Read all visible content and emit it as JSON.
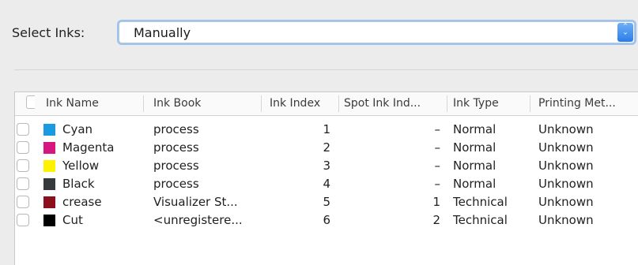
{
  "select_inks": {
    "label": "Select Inks:",
    "value": "Manually"
  },
  "table": {
    "columns": [
      "Ink Name",
      "Ink Book",
      "Ink Index",
      "Spot Ink Ind...",
      "Ink Type",
      "Printing Met..."
    ],
    "rows": [
      {
        "name": "Cyan",
        "book": "process",
        "index": "1",
        "spot": "–",
        "type": "Normal",
        "printing": "Unknown",
        "color": "#1a9ae0"
      },
      {
        "name": "Magenta",
        "book": "process",
        "index": "2",
        "spot": "–",
        "type": "Normal",
        "printing": "Unknown",
        "color": "#d5177f"
      },
      {
        "name": "Yellow",
        "book": "process",
        "index": "3",
        "spot": "–",
        "type": "Normal",
        "printing": "Unknown",
        "color": "#fff200"
      },
      {
        "name": "Black",
        "book": "process",
        "index": "4",
        "spot": "–",
        "type": "Normal",
        "printing": "Unknown",
        "color": "#373a3d"
      },
      {
        "name": "crease",
        "book": "Visualizer St...",
        "index": "5",
        "spot": "1",
        "type": "Technical",
        "printing": "Unknown",
        "color": "#8c0f1e"
      },
      {
        "name": "Cut",
        "book": "<unregistere...",
        "index": "6",
        "spot": "2",
        "type": "Technical",
        "printing": "Unknown",
        "color": "#000000"
      }
    ]
  }
}
